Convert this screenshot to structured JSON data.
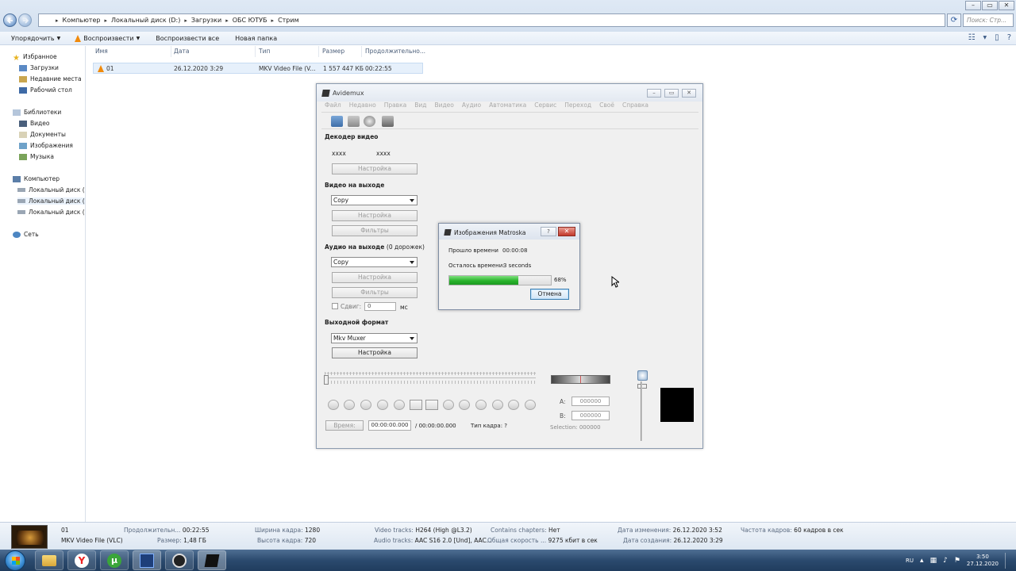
{
  "explorer": {
    "breadcrumbs": [
      "Компьютер",
      "Локальный диск (D:)",
      "Загрузки",
      "ОБС ЮТУБ",
      "Стрим"
    ],
    "search_placeholder": "Поиск: Стр...",
    "toolbar": {
      "organize": "Упорядочить",
      "play": "Воспроизвести",
      "play_all": "Воспроизвести все",
      "new_folder": "Новая папка"
    },
    "nav": {
      "favorites": "Избранное",
      "downloads": "Загрузки",
      "recent": "Недавние места",
      "desktop": "Рабочий стол",
      "libraries": "Библиотеки",
      "video": "Видео",
      "documents": "Документы",
      "images": "Изображения",
      "music": "Музыка",
      "computer": "Компьютер",
      "disk_c": "Локальный диск (C",
      "disk_d": "Локальный диск (D",
      "disk_e": "Локальный диск (E",
      "network": "Сеть"
    },
    "columns": {
      "name": "Имя",
      "date": "Дата",
      "type": "Тип",
      "size": "Размер",
      "duration": "Продолжительно..."
    },
    "file": {
      "name": "01",
      "date": "26.12.2020 3:29",
      "type": "MKV Video File (V...",
      "size": "1 557 447 КБ",
      "duration": "00:22:55"
    }
  },
  "avidemux": {
    "title": "Avidemux",
    "menu": [
      "Файл",
      "Недавно",
      "Правка",
      "Вид",
      "Видео",
      "Аудио",
      "Автоматика",
      "Сервис",
      "Переход",
      "Своё",
      "Справка"
    ],
    "decoder_header": "Декодер видео",
    "decoder_val1": "xxxx",
    "decoder_val2": "xxxx",
    "settings": "Настройка",
    "filters": "Фильтры",
    "video_out_header": "Видео на выходе",
    "video_codec": "Copy",
    "audio_out_header": "Аудио на выходе",
    "audio_tracks": "(0 дорожек)",
    "audio_codec": "Copy",
    "shift_label": "Сдвиг:",
    "shift_value": "0",
    "shift_unit": "мс",
    "format_header": "Выходной формат",
    "muxer": "Mkv Muxer",
    "a_label": "A:",
    "a_value": "000000",
    "b_label": "B:",
    "b_value": "000000",
    "selection": "Selection: 000000",
    "time_button": "Время:",
    "current_time": "00:00:00.000",
    "total_time": "/ 00:00:00.000",
    "frame_type": "Тип кадра:  ?"
  },
  "dialog": {
    "title": "Изображения Matroska",
    "elapsed_label": "Прошло времени",
    "elapsed_value": "00:00:08",
    "remaining_label": "Осталось времени:",
    "remaining_value": "3 seconds",
    "progress": 68,
    "progress_text": "68%",
    "cancel": "Отмена"
  },
  "details": {
    "name": "01",
    "type": "MKV Video File (VLC)",
    "duration_label": "Продолжительн...",
    "duration_value": "00:22:55",
    "size_label": "Размер:",
    "size_value": "1,48 ГБ",
    "width_label": "Ширина кадра:",
    "width_value": "1280",
    "height_label": "Высота кадра:",
    "height_value": "720",
    "video_tracks_label": "Video tracks:",
    "video_tracks_value": "H264 (High @L3.2)",
    "audio_tracks_label": "Audio tracks:",
    "audio_tracks_value": "AAC S16 2.0 [Und], AAC...",
    "chapters_label": "Contains chapters:",
    "chapters_value": "Нет",
    "bitrate_label": "Общая скорость ...",
    "bitrate_value": "9275 кбит в сек",
    "modified_label": "Дата изменения:",
    "modified_value": "26.12.2020 3:52",
    "created_label": "Дата создания:",
    "created_value": "26.12.2020 3:29",
    "fps_label": "Частота кадров:",
    "fps_value": "60 кадров в сек"
  },
  "taskbar": {
    "lang": "RU",
    "time": "3:50",
    "date": "27.12.2020"
  },
  "colors": {
    "progress_green": "#29b32c",
    "taskbar": "#2b4a6e",
    "explorer_header": "#dfe9f5"
  }
}
